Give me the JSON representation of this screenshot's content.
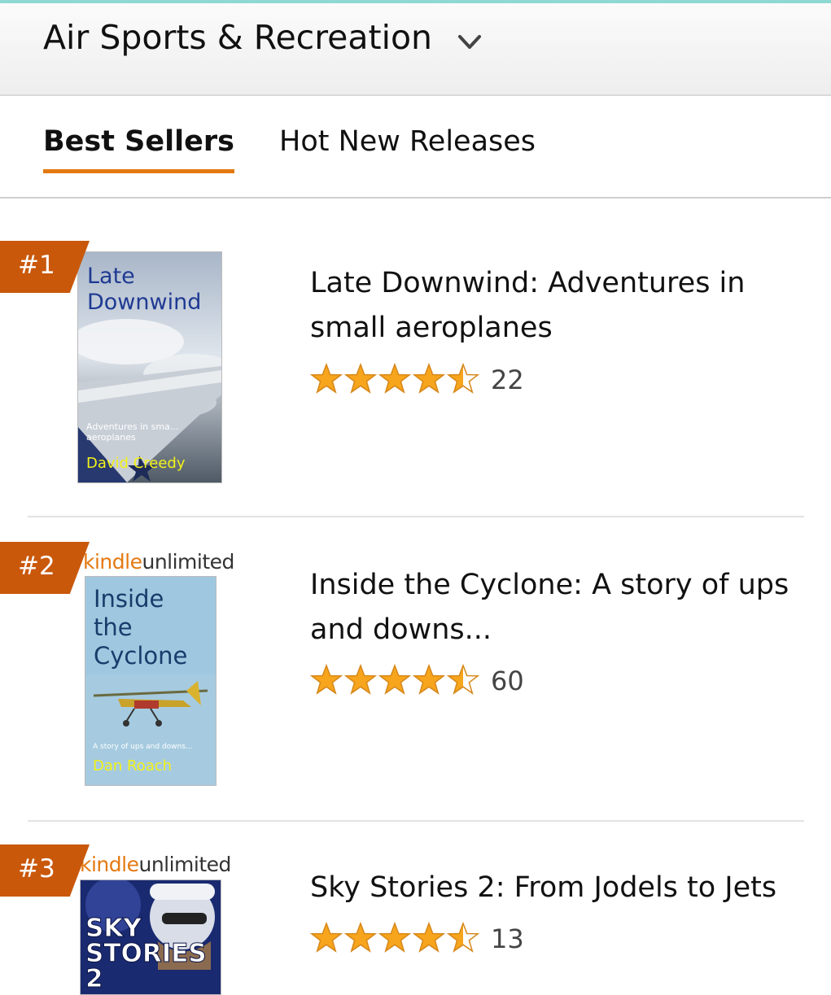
{
  "header": {
    "category": "Air Sports & Recreation",
    "chevron_icon": "chevron-down-icon"
  },
  "tabs": [
    {
      "label": "Best Sellers",
      "active": true
    },
    {
      "label": "Hot New Releases",
      "active": false
    }
  ],
  "colors": {
    "accent": "#e47911",
    "rank_badge": "#c9580b",
    "star": "#f7a51c"
  },
  "items": [
    {
      "rank": "#1",
      "kindle_unlimited": false,
      "title": "Late Downwind: Adventures in small aeroplanes",
      "rating": 4.5,
      "reviews": "22",
      "cover": {
        "title_line1": "Late",
        "title_line2": "Downwind",
        "subtitle_line1": "Adventures in sma...",
        "subtitle_line2": "aeroplanes",
        "author": "David Creedy"
      }
    },
    {
      "rank": "#2",
      "kindle_unlimited": true,
      "ku_label_part1": "kindle",
      "ku_label_part2": "unlimited",
      "title": "Inside the Cyclone: A story of ups and downs...",
      "rating": 4.5,
      "reviews": "60",
      "cover": {
        "title_line1": "Inside",
        "title_line2": "the",
        "title_line3": "Cyclone",
        "subtitle": "A story of ups and downs...",
        "author": "Dan Roach"
      }
    },
    {
      "rank": "#3",
      "kindle_unlimited": true,
      "ku_label_part1": "kindle",
      "ku_label_part2": "unlimited",
      "title": "Sky Stories 2: From Jodels to Jets",
      "rating": 4.5,
      "reviews": "13",
      "cover": {
        "title_line1": "SKY",
        "title_line2": "STORIES",
        "title_line3": "2"
      }
    }
  ]
}
